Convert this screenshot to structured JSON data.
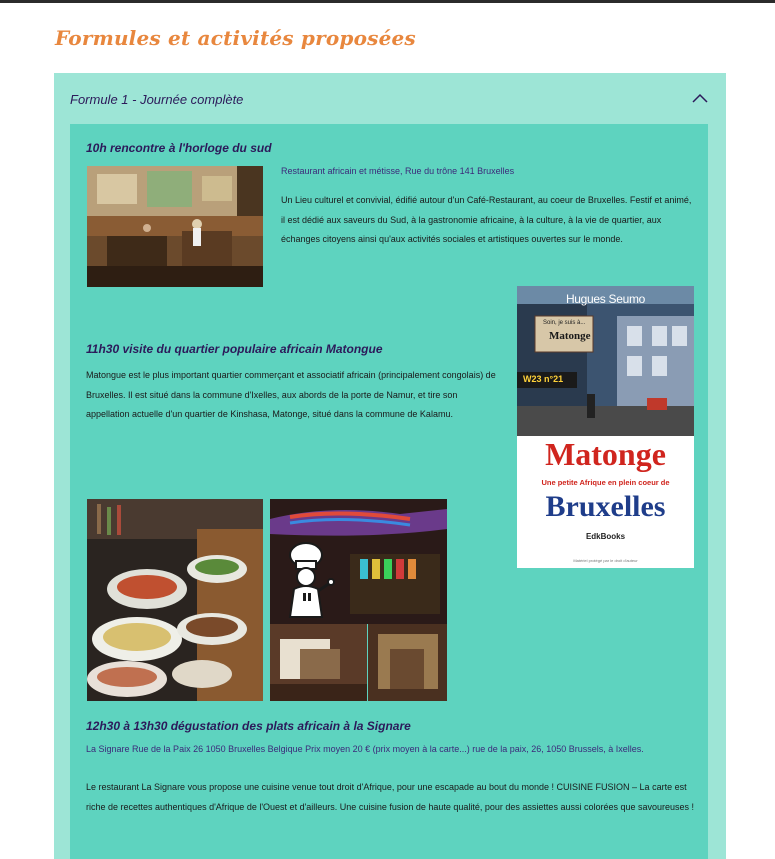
{
  "page": {
    "title": "Formules et activités proposées"
  },
  "accordion": {
    "title": "Formule 1 - Journée complète",
    "expanded": true,
    "colors": {
      "panel": "#9de5d6",
      "body": "#5ed3bf",
      "heading": "#2c1a5a",
      "title_accent": "#e8873e"
    }
  },
  "sections": [
    {
      "heading": "10h rencontre à l'horloge du sud",
      "link": "Restaurant africain et métisse, Rue du trône 141 Bruxelles",
      "paragraph": "Un Lieu culturel et convivial, édifié autour d'un Café-Restaurant, au coeur de Bruxelles. Festif et animé, il est dédié aux saveurs du Sud, à la gastronomie africaine, à la culture, à la vie de quartier, aux échanges citoyens ainsi qu'aux activités sociales et artistiques ouvertes sur le monde."
    },
    {
      "heading": "11h30 visite du quartier populaire africain Matongue",
      "paragraph": "Matongue est le plus important quartier commerçant et associatif africain (principalement congolais) de Bruxelles. Il est situé dans la commune d'Ixelles, aux abords de la porte de Namur, et tire son appellation actuelle d'un quartier de Kinshasa, Matonge, situé dans la commune de Kalamu."
    },
    {
      "heading": "12h30 à 13h30 dégustation des plats africain à la Signare",
      "link": "La Signare Rue de la Paix 26 1050 Bruxelles Belgique Prix moyen 20 € (prix moyen à la carte...) rue de la paix, 26, 1050 Brussels, à Ixelles.",
      "paragraph": "Le restaurant La Signare vous propose une cuisine venue tout droit d'Afrique, pour une escapade au bout du monde ! CUISINE FUSION – La carte est riche de recettes authentiques d'Afrique de l'Ouest et d'ailleurs. Une cuisine fusion de haute qualité, pour des assiettes aussi colorées que savoureuses !"
    }
  ],
  "book_cover": {
    "author": "Hugues Seumo",
    "shop_sign": "Matonge",
    "shop_sign_top": "Soin, je suis à...",
    "shop_number": "W23 n°21",
    "title": "Matonge",
    "subtitle": "Une petite Afrique en plein coeur de",
    "title2": "Bruxelles",
    "publisher": "EdkBooks",
    "footer": "Matériel protégé par le droit d'auteur",
    "header_small": "Matériel protégé par le droit d'auteur"
  },
  "images": {
    "cafe_photo": "restaurant interior photo",
    "buffet_photo": "buffet photo",
    "bar_collage": "restaurant bar collage",
    "chef_icon": "chef-icon"
  }
}
